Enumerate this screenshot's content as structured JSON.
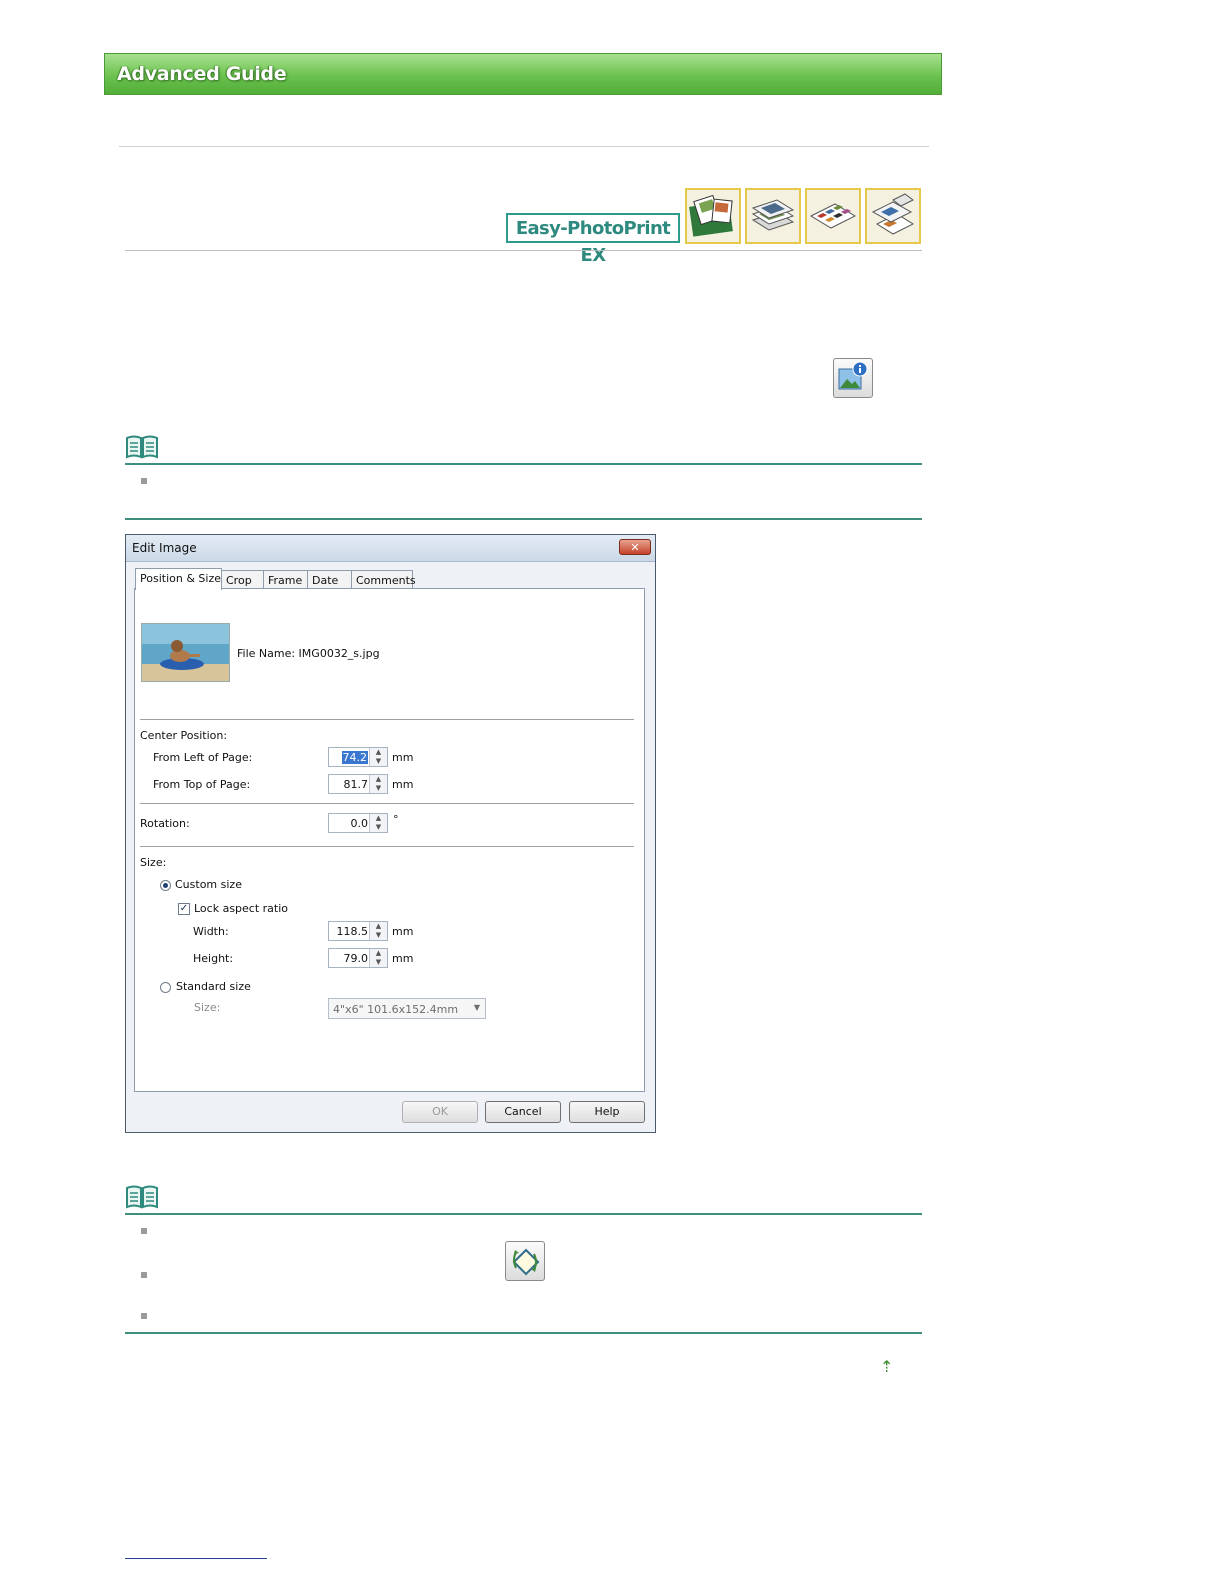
{
  "header": {
    "title": "Advanced Guide"
  },
  "product": {
    "badge": "Easy-PhotoPrint EX",
    "thumbnails": [
      "album-icon",
      "stacked-photos-icon",
      "layout-print-icon",
      "sticker-print-icon"
    ]
  },
  "icons": {
    "info": "image-info-icon",
    "note": "note-book-icon",
    "fix": "fix-image-icon",
    "top": "page-top-arrow-icon"
  },
  "dialog": {
    "title": "Edit Image",
    "close_label": "✕",
    "tabs": [
      {
        "label": "Position & Size",
        "active": true
      },
      {
        "label": "Crop",
        "active": false
      },
      {
        "label": "Frame",
        "active": false
      },
      {
        "label": "Date",
        "active": false
      },
      {
        "label": "Comments",
        "active": false
      }
    ],
    "file_name": "File Name: IMG0032_s.jpg",
    "center_position": {
      "label": "Center Position:",
      "from_left_label": "From Left of Page:",
      "from_left_value": "74.2",
      "from_top_label": "From Top of Page:",
      "from_top_value": "81.7",
      "unit": "mm"
    },
    "rotation": {
      "label": "Rotation:",
      "value": "0.0",
      "unit": "°"
    },
    "size": {
      "label": "Size:",
      "custom_label": "Custom size",
      "custom_selected": true,
      "lock_label": "Lock aspect ratio",
      "lock_checked": true,
      "width_label": "Width:",
      "width_value": "118.5",
      "height_label": "Height:",
      "height_value": "79.0",
      "unit": "mm",
      "standard_label": "Standard size",
      "standard_size_label": "Size:",
      "standard_size_value": "4\"x6\" 101.6x152.4mm"
    },
    "buttons": {
      "ok": "OK",
      "cancel": "Cancel",
      "help": "Help"
    }
  },
  "colors": {
    "banner_green": "#6cc24e",
    "rule_teal": "#3e8f7f",
    "badge_teal": "#2e9a8c"
  }
}
